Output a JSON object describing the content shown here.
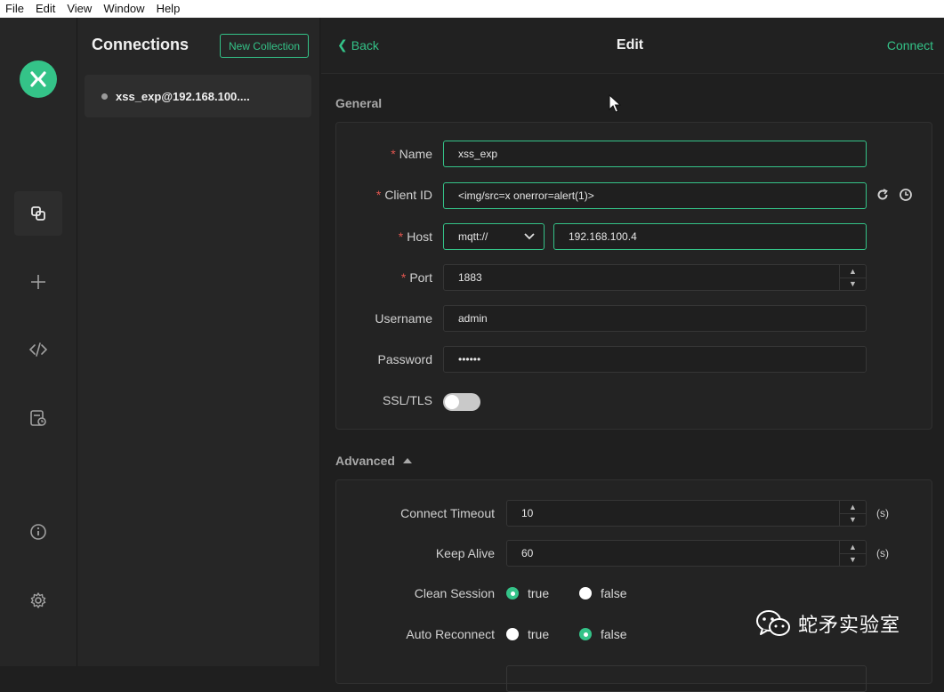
{
  "menubar": [
    "File",
    "Edit",
    "View",
    "Window",
    "Help"
  ],
  "sidebar": {
    "title": "Connections",
    "new_collection": "New Collection",
    "connection": {
      "name": "xss_exp@192.168.100...."
    }
  },
  "header": {
    "back": "Back",
    "title": "Edit",
    "connect": "Connect"
  },
  "general": {
    "label": "General",
    "name": {
      "label": "Name",
      "value": "xss_exp"
    },
    "client_id": {
      "label": "Client ID",
      "value": "<img/src=x onerror=alert(1)>"
    },
    "host": {
      "label": "Host",
      "protocol": "mqtt://",
      "value": "192.168.100.4"
    },
    "port": {
      "label": "Port",
      "value": "1883"
    },
    "username": {
      "label": "Username",
      "value": "admin"
    },
    "password": {
      "label": "Password",
      "value": "••••••"
    },
    "ssl": {
      "label": "SSL/TLS",
      "enabled": false
    }
  },
  "advanced": {
    "label": "Advanced",
    "connect_timeout": {
      "label": "Connect Timeout",
      "value": "10",
      "unit": "(s)"
    },
    "keep_alive": {
      "label": "Keep Alive",
      "value": "60",
      "unit": "(s)"
    },
    "clean_session": {
      "label": "Clean Session",
      "options": [
        "true",
        "false"
      ],
      "selected": "true"
    },
    "auto_reconnect": {
      "label": "Auto Reconnect",
      "options": [
        "true",
        "false"
      ],
      "selected": "false"
    }
  },
  "watermark": {
    "text": "蛇矛实验室"
  },
  "colors": {
    "accent": "#34c388",
    "required": "#e0554f",
    "background": "#1f1f1f"
  }
}
